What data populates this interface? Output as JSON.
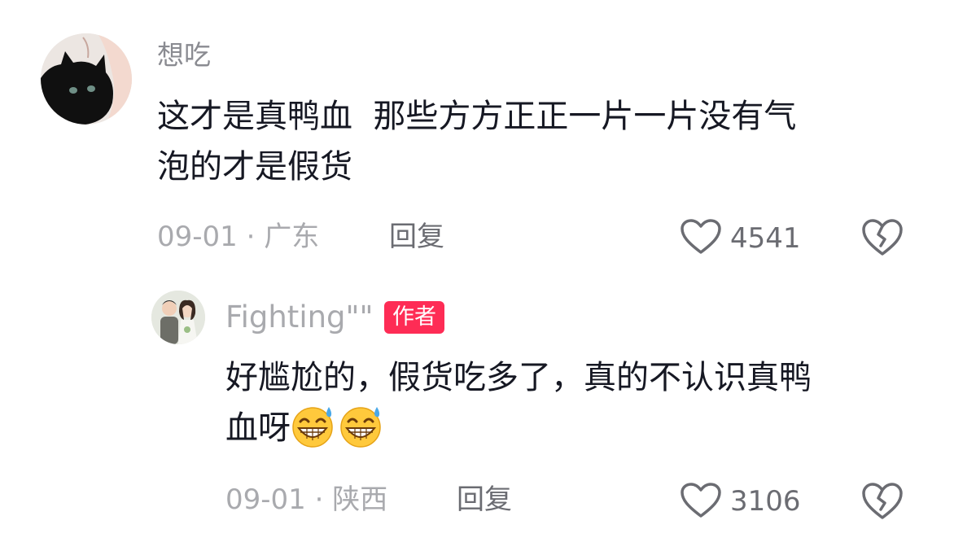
{
  "comment": {
    "username": "想吃",
    "text_line1": "这才是真鸭血  那些方方正正一片一片没有气",
    "text_line2": "泡的才是假货",
    "date_location": "09-01 · 广东",
    "reply_label": "回复",
    "like_count": "4541",
    "icons": {
      "like": "heart-outline-icon",
      "dislike": "broken-heart-icon"
    }
  },
  "reply": {
    "username": "Fighting\"\"",
    "badge": "作者",
    "badge_color": "#fe2c55",
    "text_line1": "好尴尬的，假货吃多了，真的不认识真鸭",
    "text_line2": "血呀",
    "emojis": [
      "grinning-sweat-emoji",
      "grinning-sweat-emoji"
    ],
    "date_location": "09-01 · 陕西",
    "reply_label": "回复",
    "like_count": "3106",
    "icons": {
      "like": "heart-outline-icon",
      "dislike": "broken-heart-icon"
    }
  }
}
